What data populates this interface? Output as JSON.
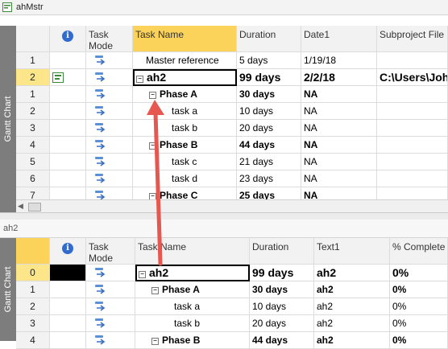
{
  "top_window": {
    "title": "ahMstr"
  },
  "bottom_window": {
    "title": "ah2"
  },
  "sidebar_label": "Gantt Chart",
  "top_table": {
    "columns": [
      "",
      "Task Mode",
      "Task Name",
      "Duration",
      "Date1",
      "Subproject File"
    ],
    "rows": [
      {
        "id": "1",
        "name": "Master reference",
        "duration": "5 days",
        "c4": "1/19/18",
        "c5": "",
        "bold": false,
        "indent": 0,
        "collapse": false,
        "selected": false
      },
      {
        "id": "2",
        "name": "ah2",
        "duration": "99 days",
        "c4": "2/2/18",
        "c5": "C:\\Users\\John",
        "bold": true,
        "indent": 0,
        "collapse": true,
        "selected": true
      },
      {
        "id": "1",
        "name": "Phase A",
        "duration": "30 days",
        "c4": "NA",
        "c5": "",
        "bold": true,
        "indent": 1,
        "collapse": true,
        "selected": false
      },
      {
        "id": "2",
        "name": "task a",
        "duration": "10 days",
        "c4": "NA",
        "c5": "",
        "bold": false,
        "indent": 2,
        "collapse": false,
        "selected": false
      },
      {
        "id": "3",
        "name": "task b",
        "duration": "20 days",
        "c4": "NA",
        "c5": "",
        "bold": false,
        "indent": 2,
        "collapse": false,
        "selected": false
      },
      {
        "id": "4",
        "name": "Phase B",
        "duration": "44 days",
        "c4": "NA",
        "c5": "",
        "bold": true,
        "indent": 1,
        "collapse": true,
        "selected": false
      },
      {
        "id": "5",
        "name": "task c",
        "duration": "21 days",
        "c4": "NA",
        "c5": "",
        "bold": false,
        "indent": 2,
        "collapse": false,
        "selected": false
      },
      {
        "id": "6",
        "name": "task d",
        "duration": "23 days",
        "c4": "NA",
        "c5": "",
        "bold": false,
        "indent": 2,
        "collapse": false,
        "selected": false
      },
      {
        "id": "7",
        "name": "Phase C",
        "duration": "25 days",
        "c4": "NA",
        "c5": "",
        "bold": true,
        "indent": 1,
        "collapse": true,
        "selected": false
      }
    ]
  },
  "bottom_table": {
    "columns": [
      "",
      "Task Mode",
      "Task Name",
      "Duration",
      "Text1",
      "% Complete"
    ],
    "rows": [
      {
        "id": "0",
        "name": "ah2",
        "duration": "99 days",
        "c4": "ah2",
        "c5": "0%",
        "bold": true,
        "indent": 0,
        "collapse": true,
        "selected": true
      },
      {
        "id": "1",
        "name": "Phase A",
        "duration": "30 days",
        "c4": "ah2",
        "c5": "0%",
        "bold": true,
        "indent": 1,
        "collapse": true,
        "selected": false
      },
      {
        "id": "2",
        "name": "task a",
        "duration": "10 days",
        "c4": "ah2",
        "c5": "0%",
        "bold": false,
        "indent": 2,
        "collapse": false,
        "selected": false
      },
      {
        "id": "3",
        "name": "task b",
        "duration": "20 days",
        "c4": "ah2",
        "c5": "0%",
        "bold": false,
        "indent": 2,
        "collapse": false,
        "selected": false
      },
      {
        "id": "4",
        "name": "Phase B",
        "duration": "44 days",
        "c4": "ah2",
        "c5": "0%",
        "bold": true,
        "indent": 1,
        "collapse": true,
        "selected": false
      }
    ]
  },
  "colors": {
    "highlight": "#fde68a",
    "arrow": "#e5574f",
    "sidebar": "#7d7d7d",
    "info": "#2f6bd1"
  },
  "icons": {
    "task_mode": "auto-schedule-arrow-icon",
    "info": "info-icon",
    "subproject": "inserted-project-icon"
  }
}
